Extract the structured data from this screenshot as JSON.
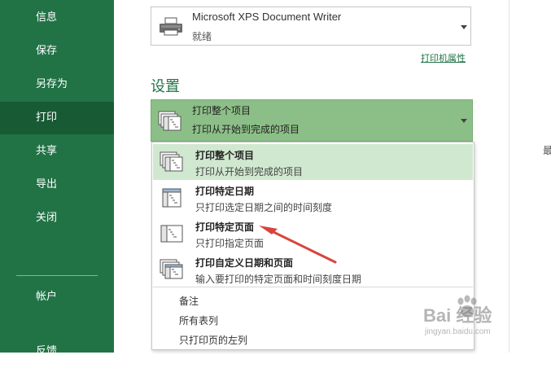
{
  "sidebar": {
    "items": [
      {
        "label": "信息"
      },
      {
        "label": "保存"
      },
      {
        "label": "另存为"
      },
      {
        "label": "打印",
        "active": true
      },
      {
        "label": "共享"
      },
      {
        "label": "导出"
      },
      {
        "label": "关闭"
      },
      {
        "label": "帐户"
      },
      {
        "label": "反馈"
      }
    ]
  },
  "printer": {
    "name": "Microsoft XPS Document Writer",
    "status": "就绪",
    "properties_link": "打印机属性"
  },
  "settings": {
    "title": "设置",
    "selected": {
      "title": "打印整个项目",
      "desc": "打印从开始到完成的项目"
    },
    "options": [
      {
        "title": "打印整个项目",
        "desc": "打印从开始到完成的项目"
      },
      {
        "title": "打印特定日期",
        "desc": "只打印选定日期之间的时间刻度"
      },
      {
        "title": "打印特定页面",
        "desc": "只打印指定页面"
      },
      {
        "title": "打印自定义日期和页面",
        "desc": "输入要打印的特定页面和时间刻度日期"
      }
    ],
    "extra_items": [
      "备注",
      "所有表列",
      "只打印页的左列"
    ]
  },
  "edge_text": "最",
  "watermark": {
    "text": "Bai 经验",
    "url": "jingyan.baidu.com"
  },
  "colors": {
    "sidebar": "#217346",
    "sidebar_active": "#185a34",
    "selected_bg": "#8cbf87",
    "highlight_bg": "#d1e8d0",
    "accent": "#217346",
    "annotation_arrow": "#d9443d"
  }
}
